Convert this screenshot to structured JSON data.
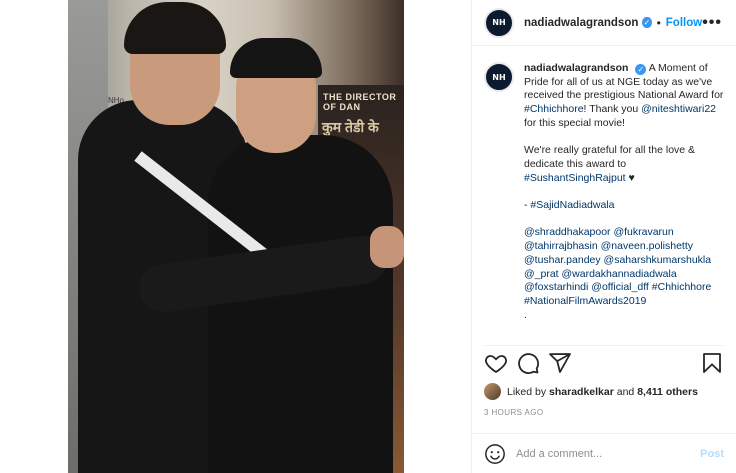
{
  "photo": {
    "poster_text": "THE DIRECTOR OF DAN",
    "poster_hindi": "कुम तेडी के",
    "sign_text": "NHo"
  },
  "post": {
    "username": "nadiadwalagrandson",
    "avatar_text": "NH",
    "follow_label": "Follow",
    "separator": "•",
    "more_label": "•••",
    "caption": {
      "username": "nadiadwalagrandson",
      "lines": [
        {
          "parts": [
            {
              "text": "A Moment of Pride for all of us at NGE today as we've received the prestigious National Award for ",
              "tag": false
            },
            {
              "text": "#Chhichhore",
              "tag": true
            },
            {
              "text": "! Thank you ",
              "tag": false
            },
            {
              "text": "@niteshtiwari22",
              "tag": true
            },
            {
              "text": " for this special movie!",
              "tag": false
            }
          ]
        }
      ],
      "para2_text": "We're really grateful for all the love & dedicate this award to ",
      "para2_tag": "#SushantSinghRajput",
      "para2_end": " ♥",
      "signoff_prefix": "- ",
      "signoff_tag": "#SajidNadiadwala",
      "mentions": [
        "@shraddhakapoor",
        "@fukravarun",
        "@tahirrajbhasin",
        "@naveen.polishetty",
        "@tushar.pandey",
        "@saharshkumarshukla",
        "@_prat",
        "@wardakhannadiadwala",
        "@foxstarhindi",
        "@official_dff",
        "#Chhichhore",
        "#NationalFilmAwards2019"
      ],
      "trailing": "."
    },
    "likes": {
      "prefix": "Liked by ",
      "user": "sharadkelkar",
      "mid": " and ",
      "count": "8,411 others"
    },
    "timestamp": "3 HOURS AGO",
    "comment": {
      "placeholder": "Add a comment...",
      "post_label": "Post"
    }
  },
  "colors": {
    "link": "#00376b",
    "follow": "#0095f6",
    "post_disabled": "#b2dffc",
    "muted": "#8e8e8e"
  },
  "icons": [
    "heart-icon",
    "comment-icon",
    "share-icon",
    "bookmark-icon",
    "emoji-icon",
    "verified-badge-icon",
    "more-icon"
  ]
}
